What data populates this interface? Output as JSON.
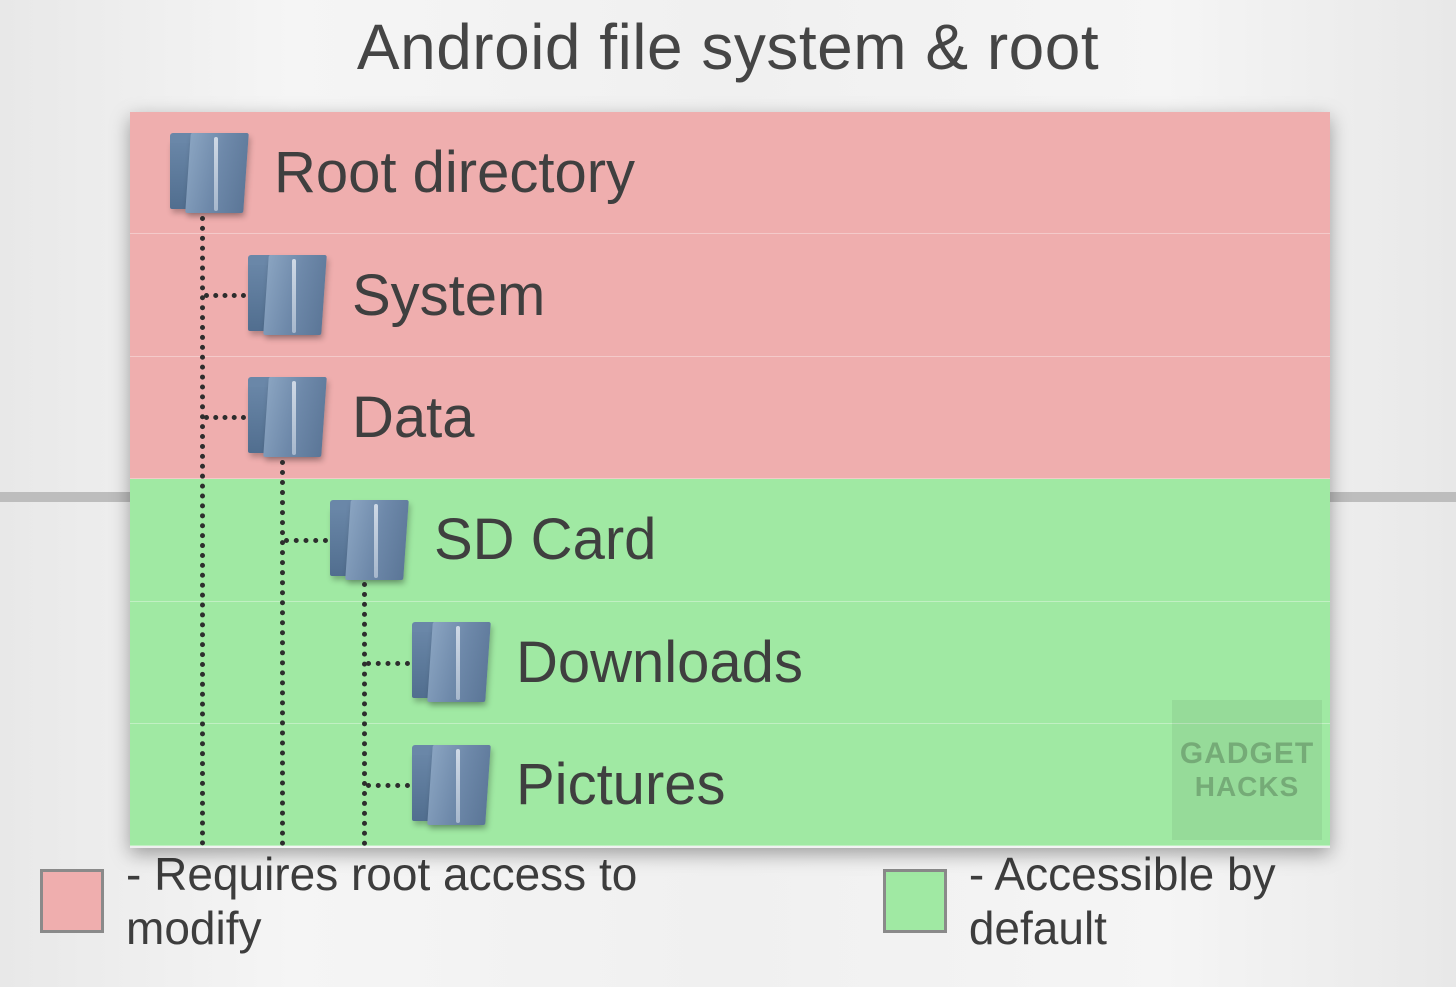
{
  "title": "Android file system & root",
  "colors": {
    "requires_root": "#efaeae",
    "accessible": "#a0e9a3"
  },
  "tree": [
    {
      "label": "Root directory",
      "indent": 0,
      "zone": "red"
    },
    {
      "label": "System",
      "indent": 1,
      "zone": "red"
    },
    {
      "label": "Data",
      "indent": 1,
      "zone": "red"
    },
    {
      "label": "SD Card",
      "indent": 2,
      "zone": "green"
    },
    {
      "label": "Downloads",
      "indent": 3,
      "zone": "green"
    },
    {
      "label": "Pictures",
      "indent": 3,
      "zone": "green"
    }
  ],
  "legend": {
    "red": "- Requires root access to modify",
    "green": "- Accessible by default"
  },
  "watermark": {
    "line1": "GADGET",
    "line2": "HACKS"
  }
}
